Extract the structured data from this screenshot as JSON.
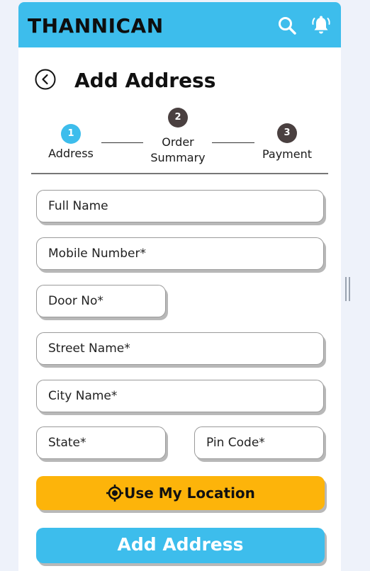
{
  "header": {
    "brand": "THANNICAN",
    "search_icon": "search-icon",
    "bell_icon": "bell-ring-icon"
  },
  "page": {
    "title": "Add Address",
    "back_icon": "chevron-left-circle-icon"
  },
  "stepper": {
    "steps": [
      {
        "number": "1",
        "label": "Address",
        "state": "active",
        "color": "#3dbdec"
      },
      {
        "number": "2",
        "label_line1": "Order",
        "label_line2": "Summary",
        "state": "pending",
        "color": "#4a4040"
      },
      {
        "number": "3",
        "label": "Payment",
        "state": "pending",
        "color": "#4a4040"
      }
    ]
  },
  "form": {
    "full_name": "Full Name",
    "mobile": "Mobile Number*",
    "door": "Door No*",
    "street": "Street Name*",
    "city": "City Name*",
    "state": "State*",
    "pin": "Pin Code*"
  },
  "actions": {
    "use_location": "Use My Location",
    "use_location_icon": "crosshair-target-icon",
    "add_address": "Add Address"
  },
  "colors": {
    "brand_blue": "#3dbdec",
    "location_yellow": "#fdb40a",
    "step_inactive": "#4a4040"
  }
}
